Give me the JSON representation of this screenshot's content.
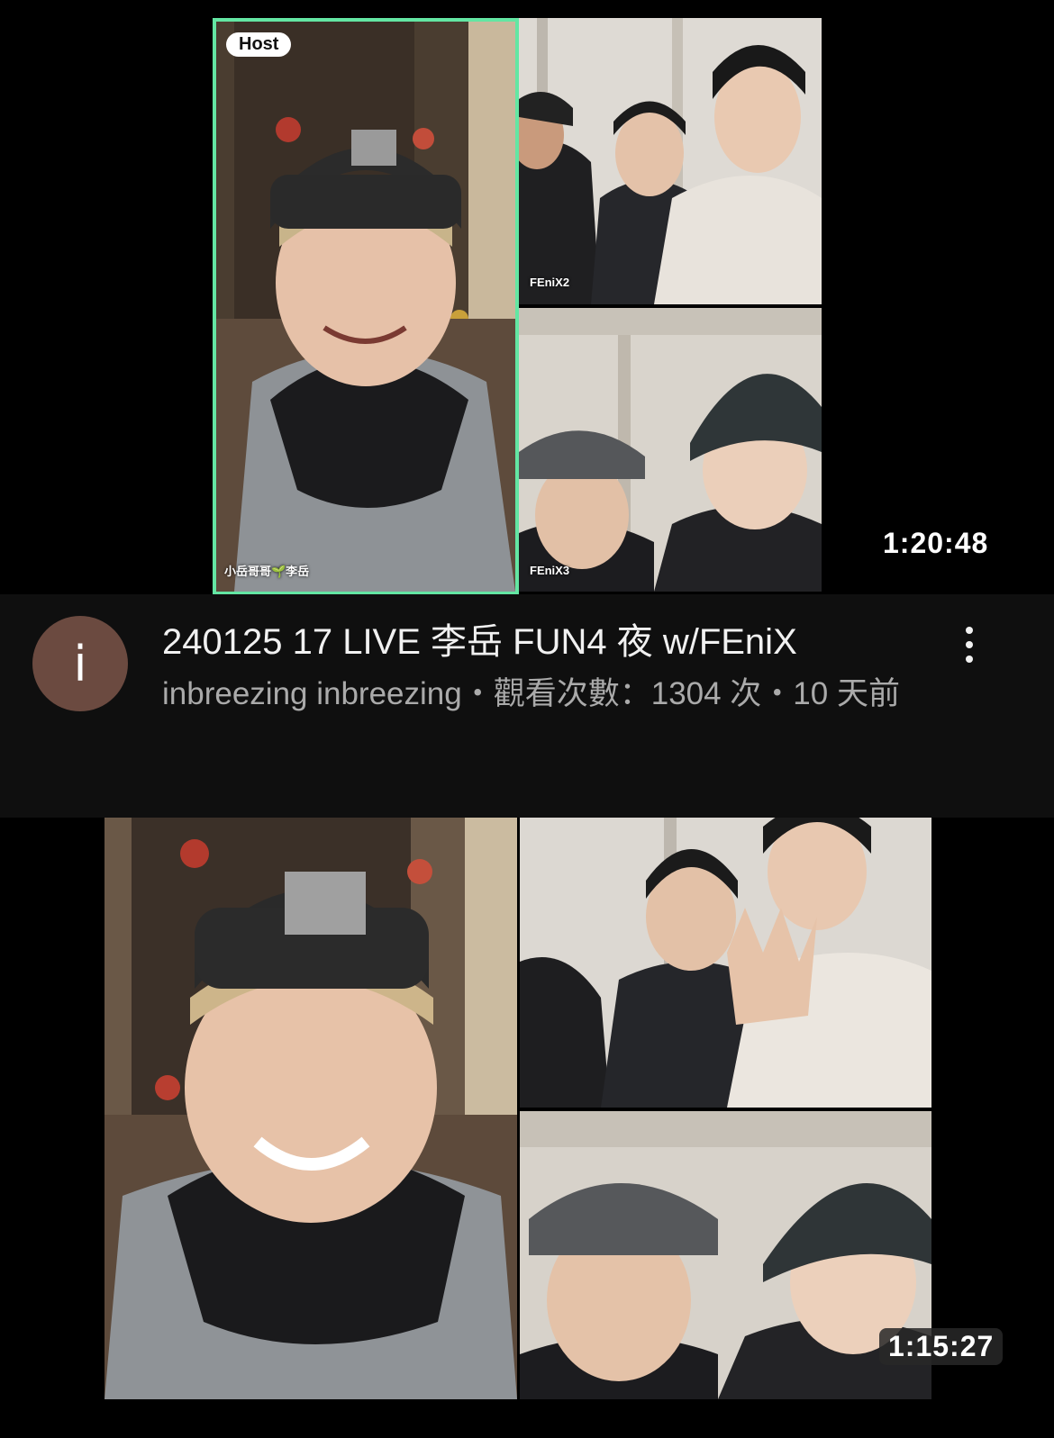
{
  "videos": [
    {
      "host_badge": "Host",
      "host_name": "小岳哥哥🌱李岳",
      "tile_labels": [
        "FEniX2",
        "FEniX3"
      ],
      "duration": "1:20:48",
      "channel_initial": "i",
      "title": "240125 17 LIVE 李岳 FUN4 夜 w/FEniX",
      "subtitle": "inbreezing inbreezing・觀看次數：1304 次・10 天前"
    },
    {
      "duration": "1:15:27"
    }
  ],
  "colors": {
    "background": "#0f0f0f",
    "host_border": "#63e6a3",
    "avatar": "#6b4a40",
    "secondary_text": "#aaaaaa"
  },
  "icons": [
    "more-vert-icon"
  ]
}
